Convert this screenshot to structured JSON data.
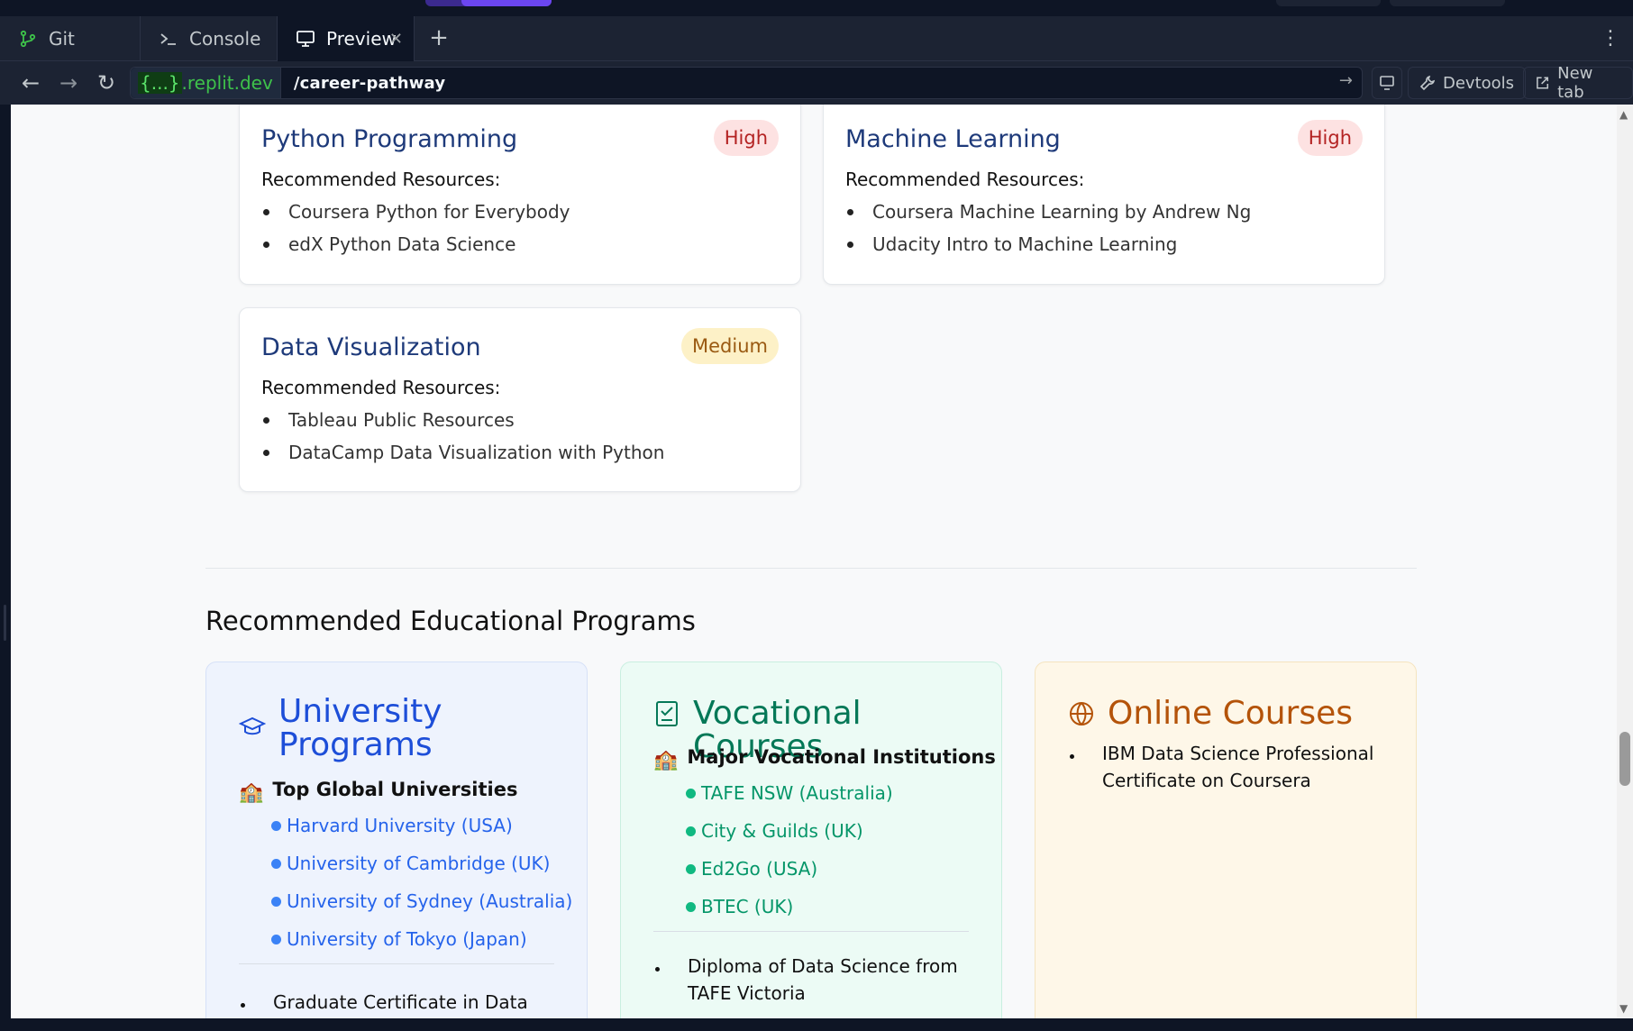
{
  "browser": {
    "tabs": [
      {
        "label": "Git",
        "icon": "git-branch-icon"
      },
      {
        "label": "Console",
        "icon": "terminal-icon"
      },
      {
        "label": "Preview",
        "icon": "monitor-icon",
        "active": true
      }
    ],
    "add_tab_symbol": "+",
    "url": {
      "domain_braces": "{...}",
      "domain": ".replit.dev",
      "path": "/career-pathway"
    },
    "buttons": {
      "devtools": "Devtools",
      "new_tab": "New tab"
    }
  },
  "skills": [
    {
      "title": "Python Programming",
      "priority": "High",
      "resources_label": "Recommended Resources:",
      "resources": [
        "Coursera Python for Everybody",
        "edX Python Data Science"
      ]
    },
    {
      "title": "Machine Learning",
      "priority": "High",
      "resources_label": "Recommended Resources:",
      "resources": [
        "Coursera Machine Learning by Andrew Ng",
        "Udacity Intro to Machine Learning"
      ]
    },
    {
      "title": "Data Visualization",
      "priority": "Medium",
      "resources_label": "Recommended Resources:",
      "resources": [
        "Tableau Public Resources",
        "DataCamp Data Visualization with Python"
      ]
    }
  ],
  "programs": {
    "section_title": "Recommended Educational Programs",
    "university": {
      "title": "University Programs",
      "subheading": "Top Global Universities",
      "institutions": [
        "Harvard University (USA)",
        "University of Cambridge (UK)",
        "University of Sydney (Australia)",
        "University of Tokyo (Japan)"
      ],
      "items": [
        "Graduate Certificate in Data"
      ]
    },
    "vocational": {
      "title": "Vocational Courses",
      "subheading": "Major Vocational Institutions",
      "institutions": [
        "TAFE NSW (Australia)",
        "City & Guilds (UK)",
        "Ed2Go (USA)",
        "BTEC (UK)"
      ],
      "items": [
        "Diploma of Data Science from TAFE Victoria"
      ]
    },
    "online": {
      "title": "Online Courses",
      "items": [
        "IBM Data Science Professional Certificate on Coursera"
      ]
    }
  },
  "colors": {
    "university_accent": "#1d4ed8",
    "vocational_accent": "#047857",
    "online_accent": "#b45309",
    "badge_high": "#b42323",
    "badge_medium": "#9a5a12"
  }
}
